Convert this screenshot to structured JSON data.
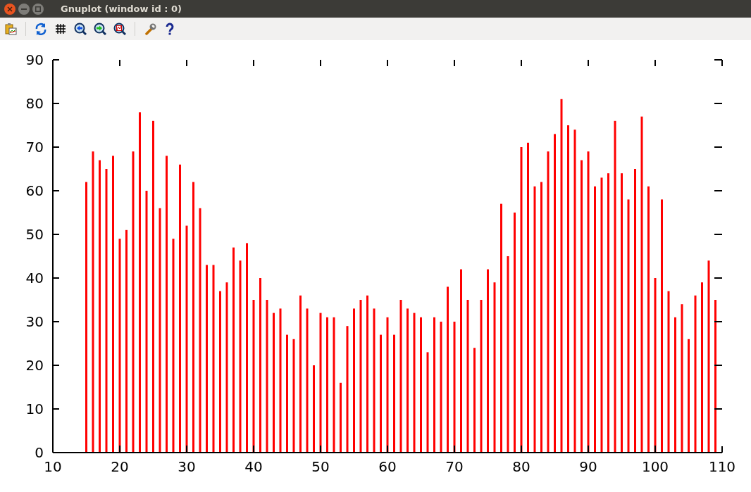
{
  "window": {
    "title": "Gnuplot (window id : 0)"
  },
  "toolbar": {
    "buttons": [
      {
        "kind": "copy"
      },
      {
        "kind": "replot"
      },
      {
        "kind": "grid"
      },
      {
        "kind": "zoom_previous"
      },
      {
        "kind": "zoom_next"
      },
      {
        "kind": "autoscale"
      },
      {
        "kind": "settings"
      },
      {
        "kind": "help"
      }
    ]
  },
  "plot": {
    "chart_data": {
      "type": "bar",
      "x": [
        15,
        16,
        17,
        18,
        19,
        20,
        21,
        22,
        23,
        24,
        25,
        26,
        27,
        28,
        29,
        30,
        31,
        32,
        33,
        34,
        35,
        36,
        37,
        38,
        39,
        40,
        41,
        42,
        43,
        44,
        45,
        46,
        47,
        48,
        49,
        50,
        51,
        52,
        53,
        54,
        55,
        56,
        57,
        58,
        59,
        60,
        61,
        62,
        63,
        64,
        65,
        66,
        67,
        68,
        69,
        70,
        71,
        72,
        73,
        74,
        75,
        76,
        77,
        78,
        79,
        80,
        81,
        82,
        83,
        84,
        85,
        86,
        87,
        88,
        89,
        90,
        91,
        92,
        93,
        94,
        95,
        96,
        97,
        98,
        99,
        100,
        101,
        102,
        103,
        104,
        105,
        106,
        107,
        108,
        109
      ],
      "series": [
        {
          "color": "#ff0000",
          "values": [
            62,
            69,
            67,
            65,
            68,
            49,
            51,
            69,
            78,
            60,
            76,
            56,
            68,
            49,
            66,
            52,
            62,
            56,
            43,
            43,
            37,
            39,
            47,
            44,
            48,
            35,
            40,
            35,
            32,
            33,
            27,
            26,
            36,
            33,
            20,
            32,
            31,
            31,
            16,
            29,
            33,
            35,
            36,
            33,
            27,
            31,
            27,
            35,
            33,
            32,
            31,
            23,
            31,
            30,
            38,
            30,
            42,
            35,
            24,
            35,
            42,
            39,
            57,
            45,
            55,
            70,
            71,
            61,
            62,
            69,
            73,
            81,
            75,
            74,
            67,
            69,
            61,
            63,
            64,
            76,
            64,
            58,
            65,
            77,
            61,
            40,
            58,
            37,
            31,
            34,
            26,
            36,
            39,
            44,
            35
          ]
        }
      ],
      "xlim": [
        10,
        110
      ],
      "ylim": [
        0,
        90
      ],
      "xticks": [
        10,
        20,
        30,
        40,
        50,
        60,
        70,
        80,
        90,
        100,
        110
      ],
      "yticks": [
        0,
        10,
        20,
        30,
        40,
        50,
        60,
        70,
        80,
        90
      ]
    }
  }
}
